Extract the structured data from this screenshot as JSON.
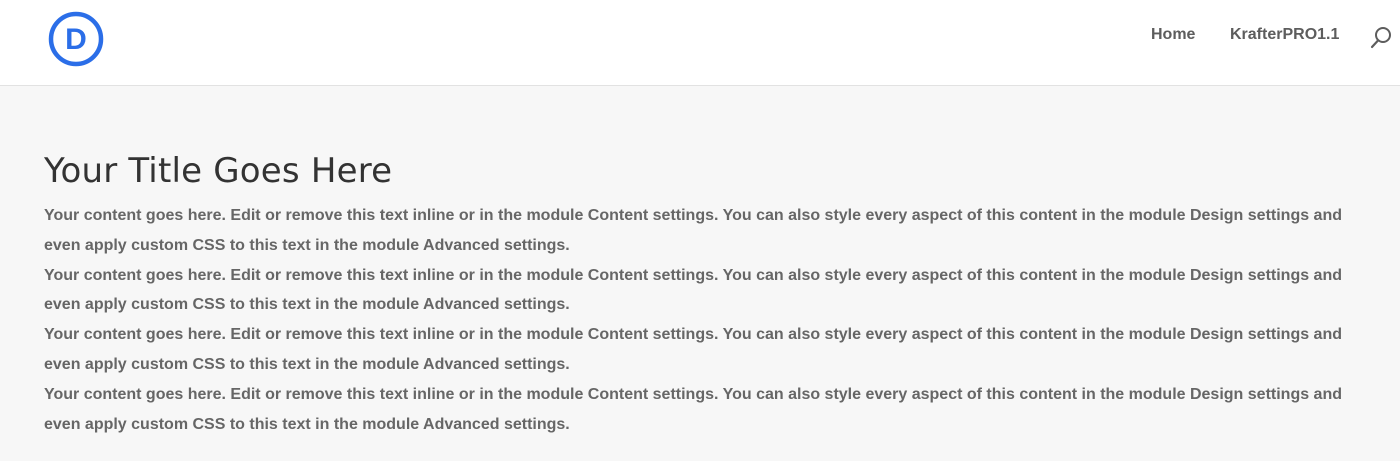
{
  "header": {
    "logo_letter": "D",
    "logo_color": "#2b6ee8",
    "nav": [
      {
        "label": "Home"
      },
      {
        "label": "KrafterPRO1.1"
      }
    ],
    "search_icon": "search-icon"
  },
  "main": {
    "title": "Your Title Goes Here",
    "paragraphs": [
      "Your content goes here. Edit or remove this text inline or in the module Content settings. You can also style every aspect of this content in the module Design settings and even apply custom CSS to this text in the module Advanced settings.",
      "Your content goes here. Edit or remove this text inline or in the module Content settings. You can also style every aspect of this content in the module Design settings and even apply custom CSS to this text in the module Advanced settings.",
      "Your content goes here. Edit or remove this text inline or in the module Content settings. You can also style every aspect of this content in the module Design settings and even apply custom CSS to this text in the module Advanced settings.",
      "Your content goes here. Edit or remove this text inline or in the module Content settings. You can also style every aspect of this content in the module Design settings and even apply custom CSS to this text in the module Advanced settings."
    ]
  }
}
